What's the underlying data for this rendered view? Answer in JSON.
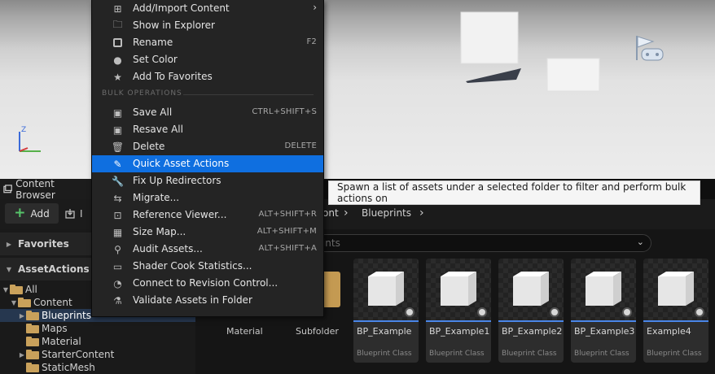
{
  "panel": {
    "tab_title": "Content Browser",
    "add_label": "Add",
    "import_label": "I"
  },
  "tree": {
    "favorites_header": "Favorites",
    "project_header": "AssetActions",
    "items": [
      {
        "label": "All",
        "arrow": "▼"
      },
      {
        "label": "Content",
        "arrow": "▼"
      },
      {
        "label": "Blueprints",
        "arrow": "▶"
      },
      {
        "label": "Maps",
        "arrow": ""
      },
      {
        "label": "Material",
        "arrow": ""
      },
      {
        "label": "StarterContent",
        "arrow": "▶"
      },
      {
        "label": "StaticMesh",
        "arrow": ""
      }
    ]
  },
  "breadcrumb": {
    "partial": "ont",
    "current": "Blueprints",
    "sep": "›"
  },
  "search": {
    "partial_placeholder": "rints"
  },
  "assets": {
    "plain_labels": [
      "Material",
      "Subfolder"
    ],
    "items": [
      {
        "name": "BP_Example",
        "class": "Blueprint Class"
      },
      {
        "name": "BP_Example1",
        "class": "Blueprint Class"
      },
      {
        "name": "BP_Example2",
        "class": "Blueprint Class"
      },
      {
        "name": "BP_Example3",
        "class": "Blueprint Class"
      },
      {
        "name": "Example4",
        "class": "Blueprint Class"
      }
    ]
  },
  "context_menu": {
    "items_top": [
      {
        "label": "Add/Import Content",
        "icon": "add-import-icon",
        "shortcut": "",
        "submenu": "›"
      },
      {
        "label": "Show in Explorer",
        "icon": "explorer-icon",
        "shortcut": ""
      },
      {
        "label": "Rename",
        "icon": "rename-icon",
        "shortcut": "F2"
      },
      {
        "label": "Set Color",
        "icon": "color-icon",
        "shortcut": ""
      },
      {
        "label": "Add To Favorites",
        "icon": "star-icon",
        "shortcut": ""
      }
    ],
    "section_header": "BULK OPERATIONS",
    "items_bulk": [
      {
        "label": "Save All",
        "icon": "save-icon",
        "shortcut": "CTRL+SHIFT+S"
      },
      {
        "label": "Resave All",
        "icon": "resave-icon",
        "shortcut": ""
      },
      {
        "label": "Delete",
        "icon": "delete-icon",
        "shortcut": "DELETE"
      },
      {
        "label": "Quick Asset Actions",
        "icon": "wand-icon",
        "shortcut": "",
        "highlighted": true
      },
      {
        "label": "Fix Up Redirectors",
        "icon": "wrench-icon",
        "shortcut": ""
      },
      {
        "label": "Migrate...",
        "icon": "migrate-icon",
        "shortcut": ""
      },
      {
        "label": "Reference Viewer...",
        "icon": "reference-icon",
        "shortcut": "ALT+SHIFT+R"
      },
      {
        "label": "Size Map...",
        "icon": "sizemap-icon",
        "shortcut": "ALT+SHIFT+M"
      },
      {
        "label": "Audit Assets...",
        "icon": "audit-icon",
        "shortcut": "ALT+SHIFT+A"
      },
      {
        "label": "Shader Cook Statistics...",
        "icon": "shader-icon",
        "shortcut": ""
      },
      {
        "label": "Connect to Revision Control...",
        "icon": "revision-icon",
        "shortcut": ""
      },
      {
        "label": "Validate Assets in Folder",
        "icon": "validate-icon",
        "shortcut": ""
      }
    ]
  },
  "tooltip": {
    "text": "Spawn a list of assets under a selected folder to filter and perform bulk actions on"
  },
  "colors": {
    "menu_highlight": "#0f6fe0",
    "selection": "#26374f",
    "folder": "#c9a15b",
    "asset_bar": "#4a86e8"
  }
}
